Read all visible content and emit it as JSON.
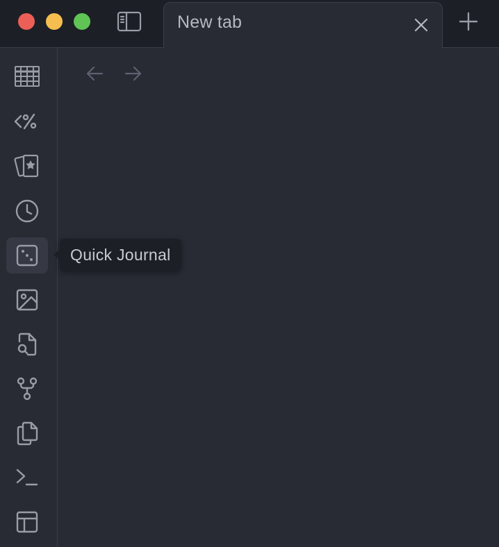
{
  "window": {
    "traffic_colors": {
      "close": "#ec5f57",
      "minimize": "#f5be4f",
      "zoom": "#5fc454"
    }
  },
  "tabs": [
    {
      "title": "New tab",
      "active": true
    }
  ],
  "ribbon": {
    "items": [
      {
        "icon": "table-icon"
      },
      {
        "icon": "template-icon"
      },
      {
        "icon": "starred-cards-icon"
      },
      {
        "icon": "clock-icon"
      },
      {
        "icon": "dice-icon",
        "active": true
      },
      {
        "icon": "image-icon"
      },
      {
        "icon": "file-search-icon"
      },
      {
        "icon": "git-fork-icon"
      },
      {
        "icon": "copy-files-icon"
      },
      {
        "icon": "terminal-icon"
      },
      {
        "icon": "layout-icon"
      }
    ]
  },
  "tooltip": {
    "text": "Quick Journal"
  },
  "colors": {
    "background": "#282a34",
    "titlebar": "#1d1f26",
    "icon": "#9a9ca6",
    "icon_dim": "#5e6170"
  }
}
